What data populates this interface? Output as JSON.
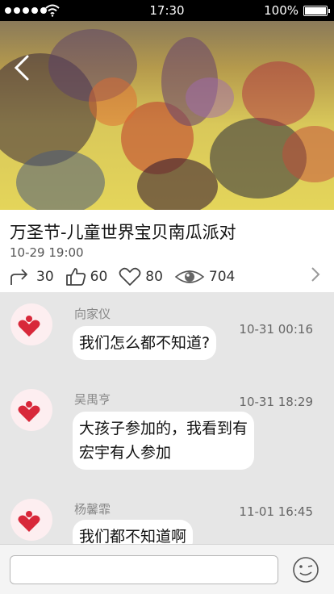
{
  "status_bar": {
    "time": "17:30",
    "battery": "100%"
  },
  "event": {
    "title": "万圣节-儿童世界宝贝南瓜派对",
    "datetime": "10-29 19:00",
    "shares": "30",
    "likes": "60",
    "favorites": "80",
    "views": "704"
  },
  "comments": [
    {
      "name": "向家仪",
      "time": "10-31 00:16",
      "text": "我们怎么都不知道?"
    },
    {
      "name": "吴禺亨",
      "time": "10-31 18:29",
      "text_line1": "大孩子参加的，我看到有",
      "text_line2": "宏宇有人参加"
    },
    {
      "name": "杨馨霏",
      "time": "11-01 16:45",
      "text": "我们都不知道啊"
    }
  ],
  "input": {
    "placeholder": ""
  },
  "colors": {
    "avatar_heart": "#d8283a",
    "avatar_bg": "#fdeef0"
  }
}
